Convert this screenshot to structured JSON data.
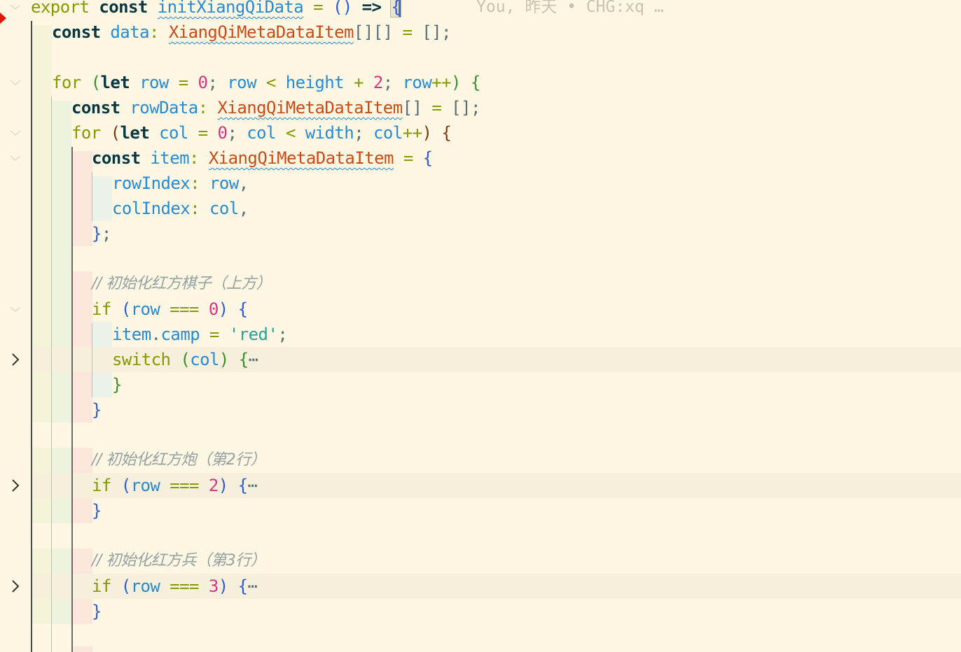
{
  "editor": {
    "blame_annotation": "You, 昨天 • CHG:xq …",
    "lines": {
      "l1": {
        "t1": "export",
        "t2": "const",
        "t3": "initXiangQiData",
        "t4": "=",
        "t5": "()",
        "t6": "=>",
        "t7": "{"
      },
      "l2": {
        "t1": "const",
        "t2": "data",
        "t3": ":",
        "t4": "XiangQiMetaDataItem",
        "t5": "[][]",
        "t6": "=",
        "t7": "[];"
      },
      "l4": {
        "t1": "for",
        "t2": "(",
        "t3": "let",
        "t4": "row",
        "t5": "=",
        "t6": "0",
        "t7": ";",
        "t8": "row",
        "t9": "<",
        "t10": "height",
        "t11": "+",
        "t12": "2",
        "t13": ";",
        "t14": "row",
        "t15": "++",
        "t16": ")",
        "t17": "{"
      },
      "l5": {
        "t1": "const",
        "t2": "rowData",
        "t3": ":",
        "t4": "XiangQiMetaDataItem",
        "t5": "[]",
        "t6": "=",
        "t7": "[];"
      },
      "l6": {
        "t1": "for",
        "t2": "(",
        "t3": "let",
        "t4": "col",
        "t5": "=",
        "t6": "0",
        "t7": ";",
        "t8": "col",
        "t9": "<",
        "t10": "width",
        "t11": ";",
        "t12": "col",
        "t13": "++",
        "t14": ")",
        "t15": "{"
      },
      "l7": {
        "t1": "const",
        "t2": "item",
        "t3": ":",
        "t4": "XiangQiMetaDataItem",
        "t5": "=",
        "t6": "{"
      },
      "l8": {
        "t1": "rowIndex",
        "t2": ":",
        "t3": "row",
        "t4": ","
      },
      "l9": {
        "t1": "colIndex",
        "t2": ":",
        "t3": "col",
        "t4": ","
      },
      "l10": {
        "t1": "}",
        "t2": ";"
      },
      "l12": {
        "t1": "// 初始化红方棋子（上方）"
      },
      "l13": {
        "t1": "if",
        "t2": "(",
        "t3": "row",
        "t4": "===",
        "t5": "0",
        "t6": ")",
        "t7": "{"
      },
      "l14": {
        "t1": "item",
        "t2": ".",
        "t3": "camp",
        "t4": "=",
        "t5": "'red'",
        "t6": ";"
      },
      "l15": {
        "t1": "switch",
        "t2": "(",
        "t3": "col",
        "t4": ")",
        "t5": "{",
        "t6": "⋯"
      },
      "l16": {
        "t1": "}"
      },
      "l17": {
        "t1": "}"
      },
      "l19": {
        "t1": "// 初始化红方炮（第2行）"
      },
      "l20": {
        "t1": "if",
        "t2": "(",
        "t3": "row",
        "t4": "===",
        "t5": "2",
        "t6": ")",
        "t7": "{",
        "t8": "⋯"
      },
      "l21": {
        "t1": "}"
      },
      "l23": {
        "t1": "// 初始化红方兵（第3行）"
      },
      "l24": {
        "t1": "if",
        "t2": "(",
        "t3": "row",
        "t4": "===",
        "t5": "3",
        "t6": ")",
        "t7": "{",
        "t8": "⋯"
      },
      "l25": {
        "t1": "}"
      }
    }
  }
}
